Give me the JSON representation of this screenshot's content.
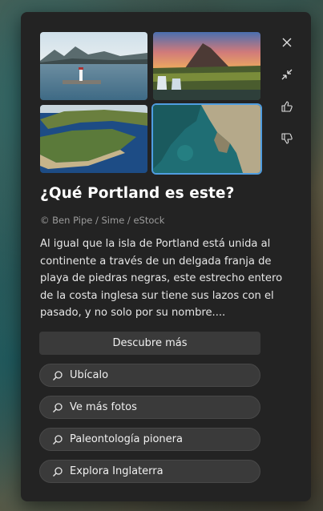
{
  "card": {
    "title": "¿Qué Portland es este?",
    "credit": "© Ben Pipe / Sime / eStock",
    "description": "Al igual que la isla de Portland está unida al continente a través de un delgada franja de playa de piedras negras, este estrecho entero de la costa inglesa sur tiene sus lazos con el pasado, y no solo por su nombre....",
    "more_button": "Descubre más",
    "chips": [
      {
        "label": "Ubícalo",
        "icon": "search-icon"
      },
      {
        "label": "Ve más fotos",
        "icon": "search-icon"
      },
      {
        "label": "Paleontología pionera",
        "icon": "search-icon"
      },
      {
        "label": "Explora Inglaterra",
        "icon": "search-icon"
      }
    ],
    "thumbnails": [
      {
        "name": "lighthouse-lake"
      },
      {
        "name": "waterfall-mountain-sunset"
      },
      {
        "name": "island-aerial"
      },
      {
        "name": "coast-cliffs-aerial",
        "selected": true
      }
    ]
  },
  "side_actions": [
    {
      "icon": "close-icon"
    },
    {
      "icon": "collapse-icon"
    },
    {
      "icon": "thumbs-up-icon"
    },
    {
      "icon": "thumbs-down-icon"
    }
  ],
  "colors": {
    "panel": "#232323",
    "accent": "#4f9de0",
    "button": "#3a3a3a"
  }
}
